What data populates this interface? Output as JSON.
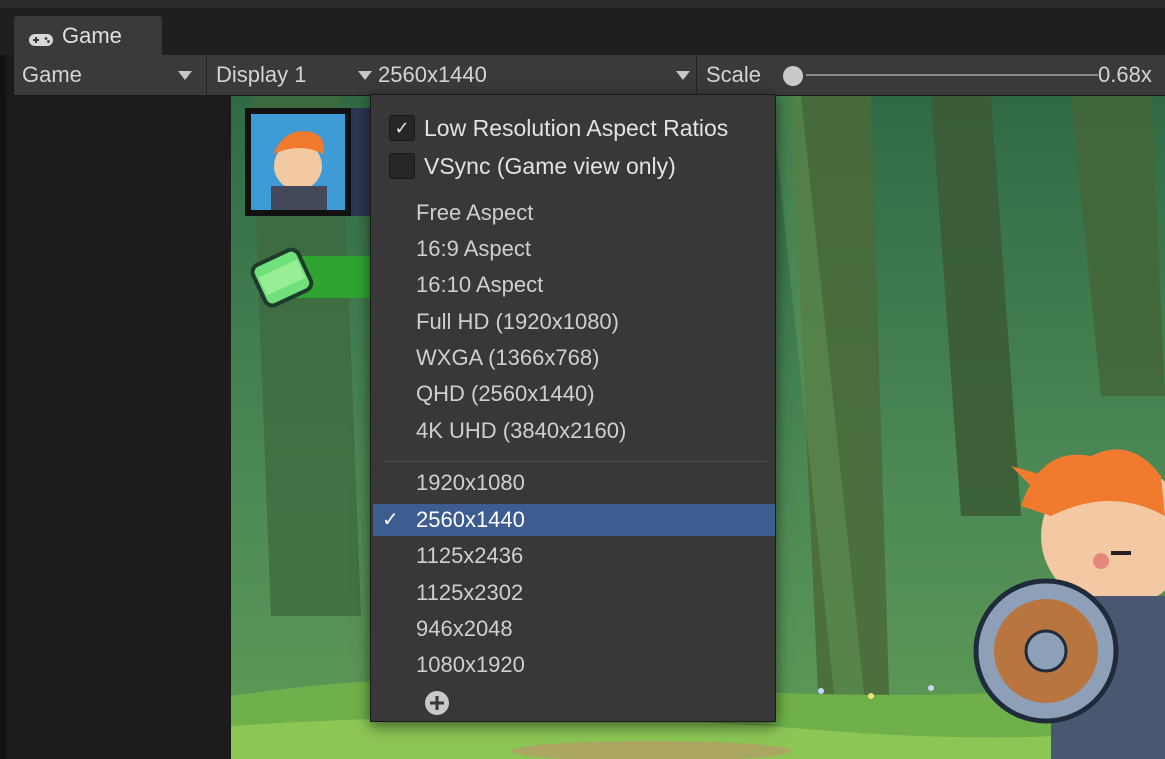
{
  "tab": {
    "label": "Game"
  },
  "toolbar": {
    "game_dropdown": "Game",
    "display_dropdown": "Display 1",
    "resolution_dropdown": "2560x1440",
    "scale_label": "Scale",
    "scale_value": "0.68x",
    "scale_slider_fraction": 0.0
  },
  "dropdown": {
    "checkboxes": [
      {
        "label": "Low Resolution Aspect Ratios",
        "checked": true
      },
      {
        "label": "VSync (Game view only)",
        "checked": false
      }
    ],
    "builtin_items": [
      "Free Aspect",
      "16:9 Aspect",
      "16:10 Aspect",
      "Full HD (1920x1080)",
      "WXGA (1366x768)",
      "QHD (2560x1440)",
      "4K UHD (3840x2160)"
    ],
    "custom_items": [
      "1920x1080",
      "2560x1440",
      "1125x2436",
      "1125x2302",
      "946x2048",
      "1080x1920"
    ],
    "selected_item": "2560x1440",
    "check_mark": "✓",
    "selected_mark": "✓"
  },
  "colors": {
    "selection": "#3d5c90",
    "panel": "#383838",
    "toolbar": "#3a3a3a"
  },
  "icons": {
    "tab": "gamepad-icon",
    "dropdown_arrow": "triangle-down-icon",
    "add": "plus-circle-icon"
  }
}
